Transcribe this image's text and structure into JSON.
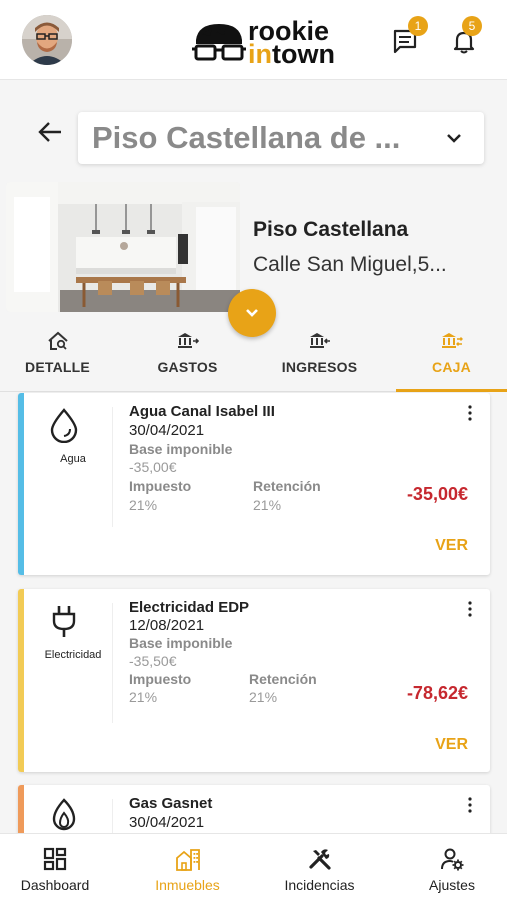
{
  "header": {
    "logo_line1": "rookie",
    "logo_line2_hl": "in",
    "logo_line2_rest": "town",
    "messages_badge": "1",
    "notifications_badge": "5"
  },
  "property": {
    "selector_title": "Piso Castellana de ...",
    "name": "Piso Castellana",
    "address": "Calle San Miguel,5..."
  },
  "tabs": [
    {
      "label": "DETALLE",
      "icon": "house-search-icon",
      "active": false
    },
    {
      "label": "GASTOS",
      "icon": "bank-out-icon",
      "active": false
    },
    {
      "label": "INGRESOS",
      "icon": "bank-in-icon",
      "active": false
    },
    {
      "label": "CAJA",
      "icon": "bank-transfer-icon",
      "active": true
    }
  ],
  "labels": {
    "base": "Base imponible",
    "tax": "Impuesto",
    "retention": "Retención",
    "view": "VER"
  },
  "expenses": [
    {
      "category": "Agua",
      "icon": "water-drop-icon",
      "color": "#55bde6",
      "title": "Agua Canal Isabel III",
      "date": "30/04/2021",
      "base": "-35,00€",
      "tax": "21%",
      "retention": "21%",
      "amount": "-35,00€"
    },
    {
      "category": "Electricidad",
      "icon": "plug-icon",
      "color": "#f2cb55",
      "title": "Electricidad EDP",
      "date": "12/08/2021",
      "base": "-35,50€",
      "tax": "21%",
      "retention": "21%",
      "amount": "-78,62€"
    },
    {
      "category": "Gas",
      "icon": "flame-icon",
      "color": "#ef9a5a",
      "title": "Gas Gasnet",
      "date": "30/04/2021"
    }
  ],
  "nav": [
    {
      "label": "Dashboard",
      "icon": "dashboard-icon",
      "active": false
    },
    {
      "label": "Inmuebles",
      "icon": "building-icon",
      "active": true
    },
    {
      "label": "Incidencias",
      "icon": "tools-icon",
      "active": false
    },
    {
      "label": "Ajustes",
      "icon": "user-settings-icon",
      "active": false
    }
  ],
  "colors": {
    "accent": "#e8a317",
    "negative": "#c6282f"
  }
}
